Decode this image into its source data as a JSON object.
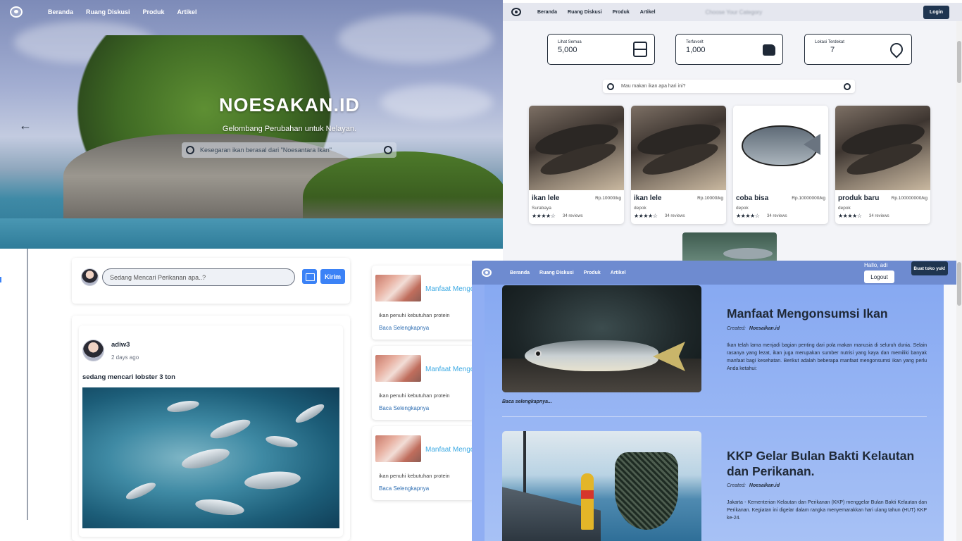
{
  "hero": {
    "nav": [
      "Beranda",
      "Ruang Diskusi",
      "Produk",
      "Artikel"
    ],
    "title": "NOESAKAN.ID",
    "subtitle": "Gelombang Perubahan untuk Nelayan.",
    "search_placeholder": "Kesegaran ikan berasal dari \"Noesantara Ikan\""
  },
  "products": {
    "nav": [
      "Beranda",
      "Ruang Diskusi",
      "Produk",
      "Artikel"
    ],
    "blurred_text": "Choose Your Category",
    "login_label": "Login",
    "stats": [
      {
        "label": "Lihat Semua",
        "value": "5,000",
        "icon": "server-icon"
      },
      {
        "label": "Terfavorit",
        "value": "1,000",
        "icon": "thumbs-up-icon"
      },
      {
        "label": "Lokasi Terdekat",
        "value": "7",
        "icon": "location-pin-icon"
      }
    ],
    "search_placeholder": "Mau makan ikan apa hari ini?",
    "cards": [
      {
        "name": "ikan lele",
        "price": "Rp.10000/kg",
        "location": "Surabaya",
        "stars": "★★★★☆",
        "reviews": "34 reviews",
        "image": "lele"
      },
      {
        "name": "ikan lele",
        "price": "Rp.10000/kg",
        "location": "depok",
        "stars": "★★★★☆",
        "reviews": "34 reviews",
        "image": "lele"
      },
      {
        "name": "coba bisa",
        "price": "Rp.10000000/kg",
        "location": "depok",
        "stars": "★★★★☆",
        "reviews": "34 reviews",
        "image": "nila"
      },
      {
        "name": "produk baru",
        "price": "Rp.100000000/kg",
        "location": "depok",
        "stars": "★★★★☆",
        "reviews": "34 reviews",
        "image": "lele"
      }
    ]
  },
  "discussion": {
    "input_placeholder": "Sedang Mencari Perikanan apa..?",
    "send_label": "Kirim",
    "post": {
      "user": "adiw3",
      "time": "2 days ago",
      "text": "sedang mencari lobster 3 ton"
    },
    "side_articles": [
      {
        "title": "Manfaat Mengonsumsi Ikan",
        "desc": "ikan penuhi kebutuhan protein",
        "more": "Baca Selengkapnya"
      },
      {
        "title": "Manfaat Mengonsumsi Ikan",
        "desc": "ikan penuhi kebutuhan protein",
        "more": "Baca Selengkapnya"
      },
      {
        "title": "Manfaat Mengonsumsi Ikan",
        "desc": "ikan penuhi kebutuhan protein",
        "more": "Baca Selengkapnya"
      }
    ]
  },
  "articles": {
    "nav": [
      "Beranda",
      "Ruang Diskusi",
      "Produk",
      "Artikel"
    ],
    "hello": "Hallo, adi",
    "logout_label": "Logout",
    "create_shop_label": "Buat toko yuk!",
    "items": [
      {
        "title": "Manfaat Mengonsumsi Ikan",
        "created_prefix": "Created:",
        "author": "Noesaikan.id",
        "body": "Ikan telah lama menjadi bagian penting dari pola makan manusia di seluruh dunia. Selain rasanya yang lezat, ikan juga merupakan sumber nutrisi yang kaya dan memiliki banyak manfaat bagi kesehatan. Berikut adalah beberapa manfaat mengonsumsi ikan yang perlu Anda ketahui:",
        "more": "Baca selengkapnya..."
      },
      {
        "title": "KKP Gelar Bulan Bakti Kelautan dan Perikanan.",
        "created_prefix": "Created:",
        "author": "Noesaikan.id",
        "body": "Jakarta - Kementerian Kelautan dan Perikanan (KKP) menggelar Bulan Bakti Kelautan dan Perikanan. Kegiatan ini digelar dalam rangka menyemarakkan hari ulang tahun (HUT) KKP ke-24."
      }
    ]
  },
  "colors": {
    "navy": "#1f3550",
    "link_blue": "#3ba9e3",
    "button_blue": "#3b82f6",
    "article_bg": "#90aef3"
  }
}
